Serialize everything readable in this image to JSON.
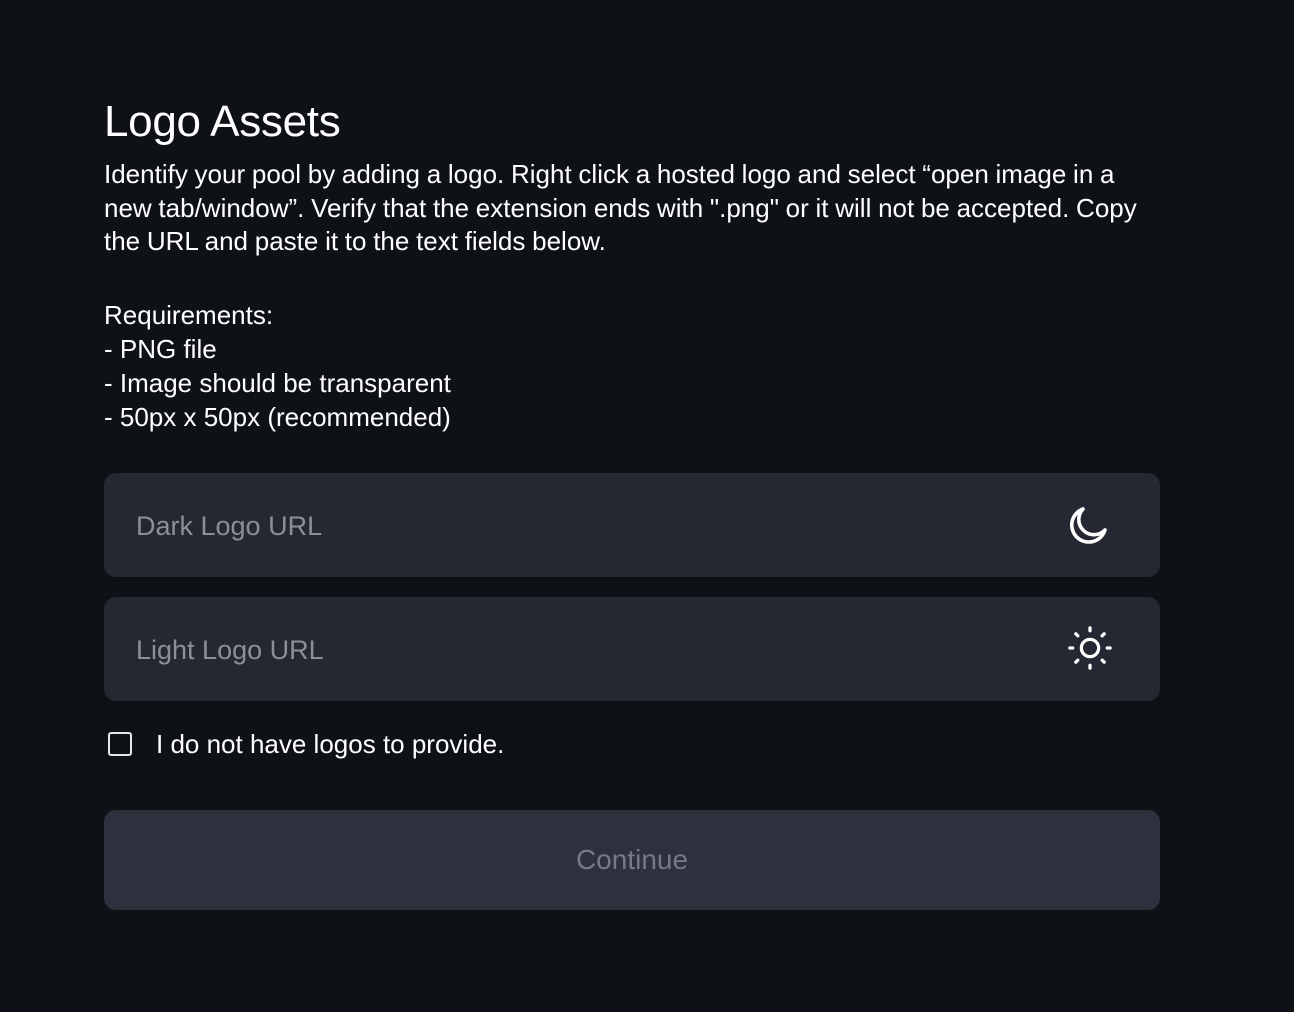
{
  "header": {
    "title": "Logo Assets",
    "description": "Identify your pool by adding a logo. Right click a hosted logo and select “open image in a new tab/window”. Verify that the extension ends with \".png\" or it will not be accepted. Copy the URL and paste it to the text fields below."
  },
  "requirements": {
    "heading": "Requirements:",
    "items": [
      "- PNG file",
      "- Image should be transparent",
      "- 50px x 50px (recommended)"
    ]
  },
  "fields": {
    "dark": {
      "placeholder": "Dark Logo URL",
      "value": "",
      "icon": "moon-icon"
    },
    "light": {
      "placeholder": "Light Logo URL",
      "value": "",
      "icon": "sun-icon"
    }
  },
  "no_logos": {
    "label": "I do not have logos to provide.",
    "checked": false
  },
  "continue": {
    "label": "Continue",
    "disabled": true
  },
  "colors": {
    "background": "#0e1116",
    "field_background": "#252833",
    "button_background": "#2e313d",
    "button_text_disabled": "#757983",
    "placeholder": "#8b8f99"
  }
}
